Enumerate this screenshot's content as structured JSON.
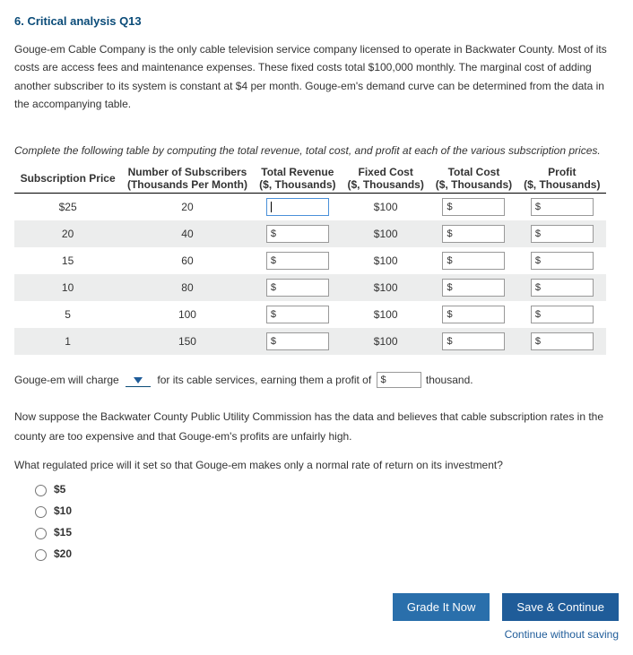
{
  "title": "6. Critical analysis Q13",
  "intro": "Gouge-em Cable Company is the only cable television service company licensed to operate in Backwater County. Most of its costs are access fees and maintenance expenses. These fixed costs total $100,000 monthly. The marginal cost of adding another subscriber to its system is constant at $4 per month. Gouge-em's demand curve can be determined from the data in the accompanying table.",
  "instruction": "Complete the following table by computing the total revenue, total cost, and profit at each of the various subscription prices.",
  "headers": {
    "col1_a": "Subscription Price",
    "col2_a": "Number of Subscribers",
    "col2_b": "(Thousands Per Month)",
    "col3_a": "Total Revenue",
    "col3_b": "($, Thousands)",
    "col4_a": "Fixed Cost",
    "col4_b": "($, Thousands)",
    "col5_a": "Total Cost",
    "col5_b": "($, Thousands)",
    "col6_a": "Profit",
    "col6_b": "($, Thousands)"
  },
  "rows": [
    {
      "price": "$25",
      "subs": "20",
      "fixed": "$100",
      "shade": false,
      "rev_prefix": "",
      "active": true
    },
    {
      "price": "20",
      "subs": "40",
      "fixed": "$100",
      "shade": true,
      "rev_prefix": "$",
      "active": false
    },
    {
      "price": "15",
      "subs": "60",
      "fixed": "$100",
      "shade": false,
      "rev_prefix": "$",
      "active": false
    },
    {
      "price": "10",
      "subs": "80",
      "fixed": "$100",
      "shade": true,
      "rev_prefix": "$",
      "active": false
    },
    {
      "price": "5",
      "subs": "100",
      "fixed": "$100",
      "shade": false,
      "rev_prefix": "$",
      "active": false
    },
    {
      "price": "1",
      "subs": "150",
      "fixed": "$100",
      "shade": true,
      "rev_prefix": "$",
      "active": false
    }
  ],
  "fill": {
    "pre": "Gouge-em will charge",
    "mid": "for its cable services, earning them a profit of",
    "prefix": "$",
    "post": "thousand."
  },
  "para2": "Now suppose the Backwater County Public Utility Commission has the data and believes that cable subscription rates in the county are too expensive and that Gouge-em's profits are unfairly high.",
  "q2": "What regulated price will it set so that Gouge-em makes only a normal rate of return on its investment?",
  "options": [
    "$5",
    "$10",
    "$15",
    "$20"
  ],
  "buttons": {
    "grade": "Grade It Now",
    "save": "Save & Continue",
    "link": "Continue without saving"
  }
}
